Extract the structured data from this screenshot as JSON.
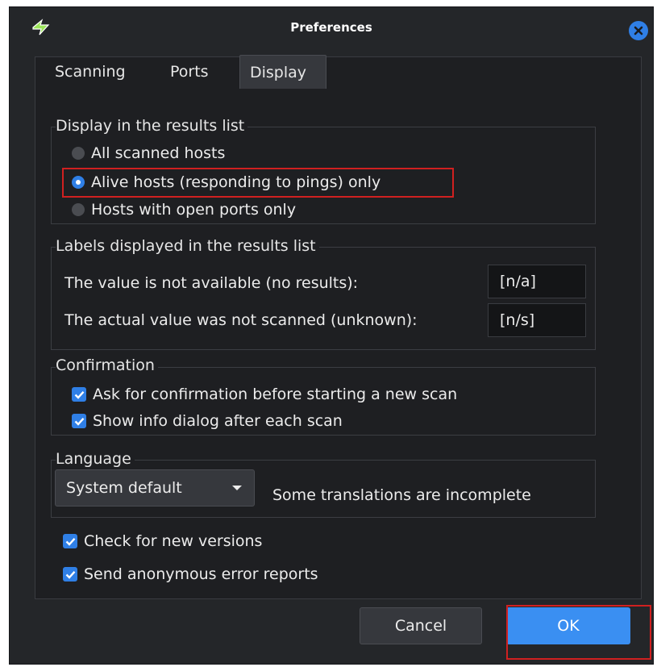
{
  "window": {
    "title": "Preferences"
  },
  "tabs": [
    {
      "label": "Scanning",
      "active": false
    },
    {
      "label": "Ports",
      "active": false
    },
    {
      "label": "Display",
      "active": true
    }
  ],
  "display_group": {
    "title": "Display in the results list",
    "options": [
      {
        "label": "All scanned hosts",
        "selected": false
      },
      {
        "label": "Alive hosts (responding to pings) only",
        "selected": true
      },
      {
        "label": "Hosts with open ports only",
        "selected": false
      }
    ]
  },
  "labels_group": {
    "title": "Labels displayed in the results list",
    "not_available_label": "The value is not available (no results):",
    "not_available_value": "[n/a]",
    "not_scanned_label": "The actual value was not scanned (unknown):",
    "not_scanned_value": "[n/s]"
  },
  "confirmation_group": {
    "title": "Confirmation",
    "ask_confirmation": "Ask for confirmation before starting a new scan",
    "show_info": "Show info dialog after each scan"
  },
  "language_group": {
    "title": "Language",
    "selected": "System default",
    "note": "Some translations are incomplete"
  },
  "extra": {
    "check_versions": "Check for new versions",
    "send_reports": "Send anonymous error reports"
  },
  "buttons": {
    "cancel": "Cancel",
    "ok": "OK"
  },
  "colors": {
    "accent": "#2f7fe6",
    "highlight": "#d02020",
    "background": "#242629"
  }
}
